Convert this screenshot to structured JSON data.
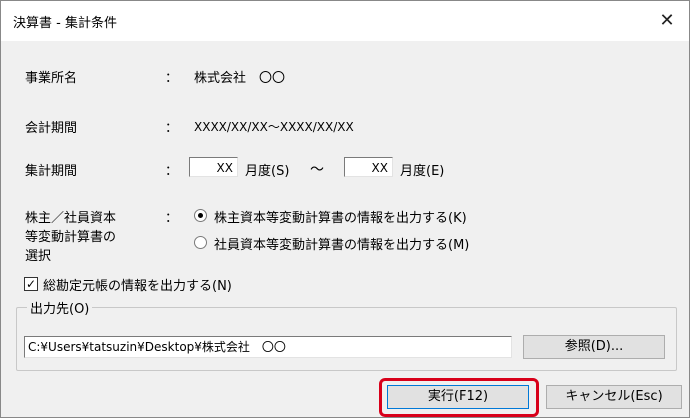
{
  "window": {
    "title": "決算書 - 集計条件",
    "close_glyph": "✕"
  },
  "fields": {
    "office_name": {
      "label": "事業所名",
      "colon": "：",
      "value": "株式会社　〇〇"
    },
    "fiscal_period": {
      "label": "会計期間",
      "colon": "：",
      "value": "XXXX/XX/XX～XXXX/XX/XX"
    },
    "aggregation_period": {
      "label": "集計期間",
      "colon": "：",
      "from_value": "XX",
      "from_suffix": "月度(S)",
      "tilde": "～",
      "to_value": "XX",
      "to_suffix": "月度(E)"
    },
    "statement_select": {
      "label_line1": "株主／社員資本",
      "label_line2": "等変動計算書の",
      "label_line3": "選択",
      "colon": "：",
      "options": [
        {
          "label": "株主資本等変動計算書の情報を出力する(K)",
          "selected": true
        },
        {
          "label": "社員資本等変動計算書の情報を出力する(M)",
          "selected": false
        }
      ]
    }
  },
  "checkbox": {
    "label": "総勘定元帳の情報を出力する(N)",
    "checked": true,
    "mark": "✓"
  },
  "output": {
    "legend": "出力先(O)",
    "path": "C:¥Users¥tatsuzin¥Desktop¥株式会社　〇〇",
    "browse_label": "参照(D)..."
  },
  "buttons": {
    "execute_label": "実行(F12)",
    "cancel_label": "キャンセル(Esc)"
  },
  "colors": {
    "highlight": "#d8001a",
    "titlebar": "#ffffff",
    "dialog_bg": "#f0f0f0"
  }
}
